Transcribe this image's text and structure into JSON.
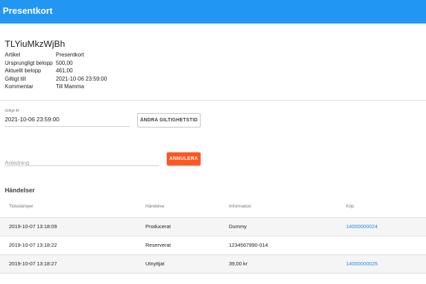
{
  "appbar": {
    "title": "Presentkort"
  },
  "card": {
    "title": "TLYiuMkzWjBh",
    "details": [
      {
        "label": "Artikel",
        "value": "Presentkort"
      },
      {
        "label": "Ursprungligt belopp",
        "value": "500,00"
      },
      {
        "label": "Aktuellt belopp",
        "value": "461,00"
      },
      {
        "label": "Giltigt till",
        "value": "2021-10-06 23:59:00"
      },
      {
        "label": "Kommentar",
        "value": "Till Mamma"
      }
    ]
  },
  "validity": {
    "label": "Giltigt till",
    "value": "2021-10-06 23:59:00",
    "button": "ÄNDRA GILTIGHETSTID"
  },
  "cancel": {
    "placeholder": "Anledning",
    "button": "ANNULERA"
  },
  "events": {
    "title": "Händelser",
    "columns": [
      "Tidsstämpel",
      "Händelse",
      "Information",
      "Köp"
    ],
    "rows": [
      {
        "timestamp": "2019-10-07 13:18:09",
        "event": "Producerat",
        "info": "Dummy",
        "purchase": "14000000024"
      },
      {
        "timestamp": "2019-10-07 13:18:22",
        "event": "Reserverat",
        "info": "1234567890-014",
        "purchase": ""
      },
      {
        "timestamp": "2019-10-07 13:18:27",
        "event": "Utnyttjat",
        "info": "39,00 kr",
        "purchase": "14000000025"
      }
    ]
  },
  "colors": {
    "primary": "#2196f3",
    "accent": "#ff5722",
    "link": "#1e88e5"
  }
}
